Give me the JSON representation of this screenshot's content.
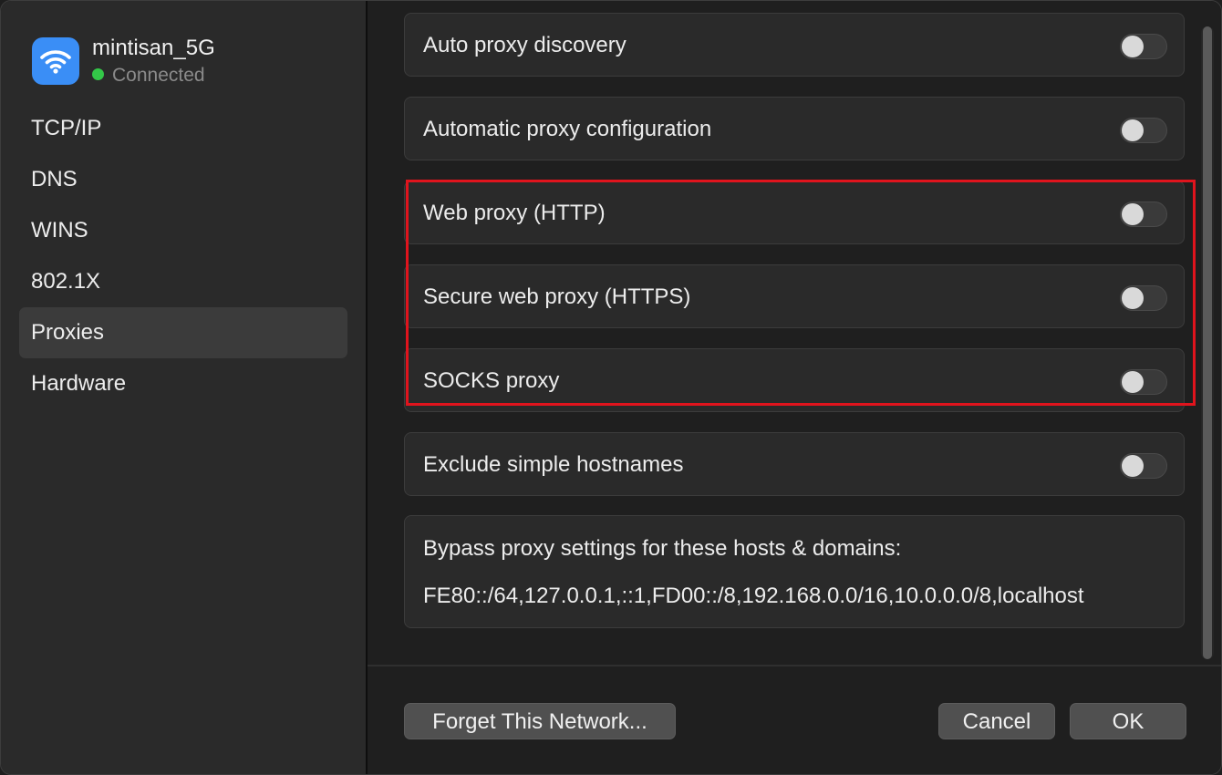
{
  "network": {
    "name": "mintisan_5G",
    "status": "Connected",
    "status_color": "#33c748",
    "icon": "wifi-icon",
    "icon_bg": "#3a8ef6"
  },
  "sidebar": {
    "items": [
      {
        "label": "TCP/IP",
        "selected": false
      },
      {
        "label": "DNS",
        "selected": false
      },
      {
        "label": "WINS",
        "selected": false
      },
      {
        "label": "802.1X",
        "selected": false
      },
      {
        "label": "Proxies",
        "selected": true
      },
      {
        "label": "Hardware",
        "selected": false
      }
    ]
  },
  "proxies": {
    "rows": [
      {
        "label": "Auto proxy discovery",
        "enabled": false
      },
      {
        "label": "Automatic proxy configuration",
        "enabled": false
      },
      {
        "label": "Web proxy (HTTP)",
        "enabled": false
      },
      {
        "label": "Secure web proxy (HTTPS)",
        "enabled": false
      },
      {
        "label": "SOCKS proxy",
        "enabled": false
      },
      {
        "label": "Exclude simple hostnames",
        "enabled": false
      }
    ],
    "bypass_title": "Bypass proxy settings for these hosts & domains:",
    "bypass_value": "FE80::/64,127.0.0.1,::1,FD00::/8,192.168.0.0/16,10.0.0.0/8,localhost",
    "highlight_color": "#e0141d"
  },
  "footer": {
    "forget_label": "Forget This Network...",
    "cancel_label": "Cancel",
    "ok_label": "OK"
  }
}
